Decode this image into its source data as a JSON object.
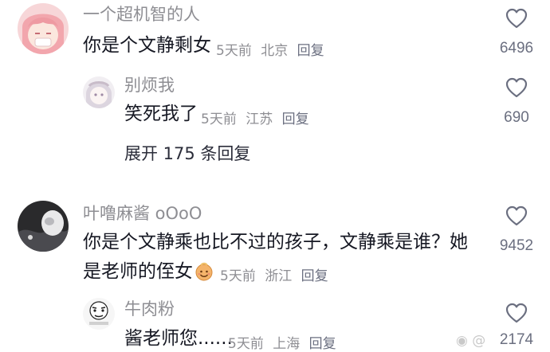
{
  "comments": [
    {
      "username": "一个超机智的人",
      "text": "你是个文静剩女",
      "time": "5天前",
      "location": "北京",
      "reply_label": "回复",
      "likes": "6496"
    },
    {
      "username": "别烦我",
      "text": "笑死我了",
      "time": "5天前",
      "location": "江苏",
      "reply_label": "回复",
      "likes": "690"
    },
    {
      "username": "叶噜麻酱 oOoO",
      "text_line1": "你是个文静乘也比不过的孩子，文静乘是谁？她",
      "text_line2": "是老师的侄女",
      "time": "5天前",
      "location": "浙江",
      "reply_label": "回复",
      "likes": "9452"
    },
    {
      "username": "牛肉粉",
      "text": "酱老师您......",
      "time": "5天前",
      "location": "上海",
      "reply_label": "回复",
      "likes": "2174"
    }
  ],
  "expand_replies": "展开 175 条回复",
  "watermark_text": "@    ",
  "colors": {
    "username": "#8e8e93",
    "content": "#161823",
    "meta": "#8e8e93",
    "background": "#ffffff"
  },
  "icons": {
    "like": "heart-outline-icon"
  }
}
